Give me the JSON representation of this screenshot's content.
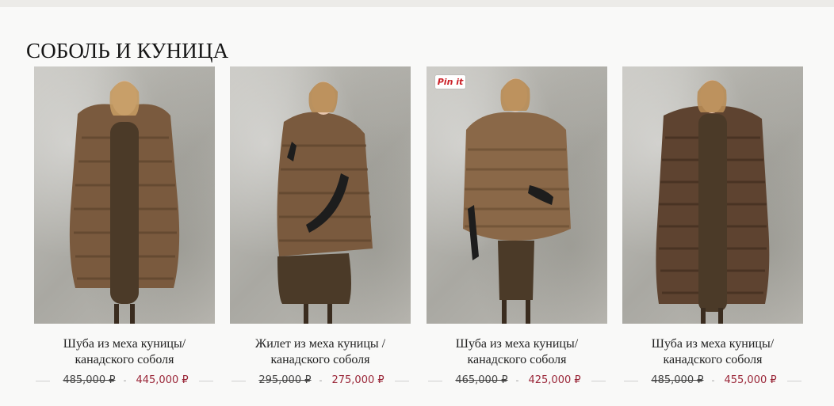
{
  "section": {
    "title": "СОБОЛЬ И КУНИЦА"
  },
  "products": [
    {
      "name_line1": "Шуба из меха куницы/",
      "name_line2": "канадского соболя",
      "old_price": "485,000 ₽",
      "new_price": "445,000 ₽",
      "separator": "-",
      "pin": ""
    },
    {
      "name_line1": "Жилет из меха куницы /",
      "name_line2": "канадского соболя",
      "old_price": "295,000 ₽",
      "new_price": "275,000 ₽",
      "separator": "-",
      "pin": ""
    },
    {
      "name_line1": "Шуба из меха куницы/",
      "name_line2": "канадского соболя",
      "old_price": "465,000 ₽",
      "new_price": "425,000 ₽",
      "separator": "-",
      "pin": "Pin it"
    },
    {
      "name_line1": "Шуба из меха куницы/",
      "name_line2": "канадского соболя",
      "old_price": "485,000 ₽",
      "new_price": "455,000 ₽",
      "separator": "-",
      "pin": ""
    }
  ],
  "colors": {
    "new_price": "#9a2638",
    "fur": "#7a5a3e",
    "dress": "#4b3a28",
    "wall": "#bcbab4"
  }
}
